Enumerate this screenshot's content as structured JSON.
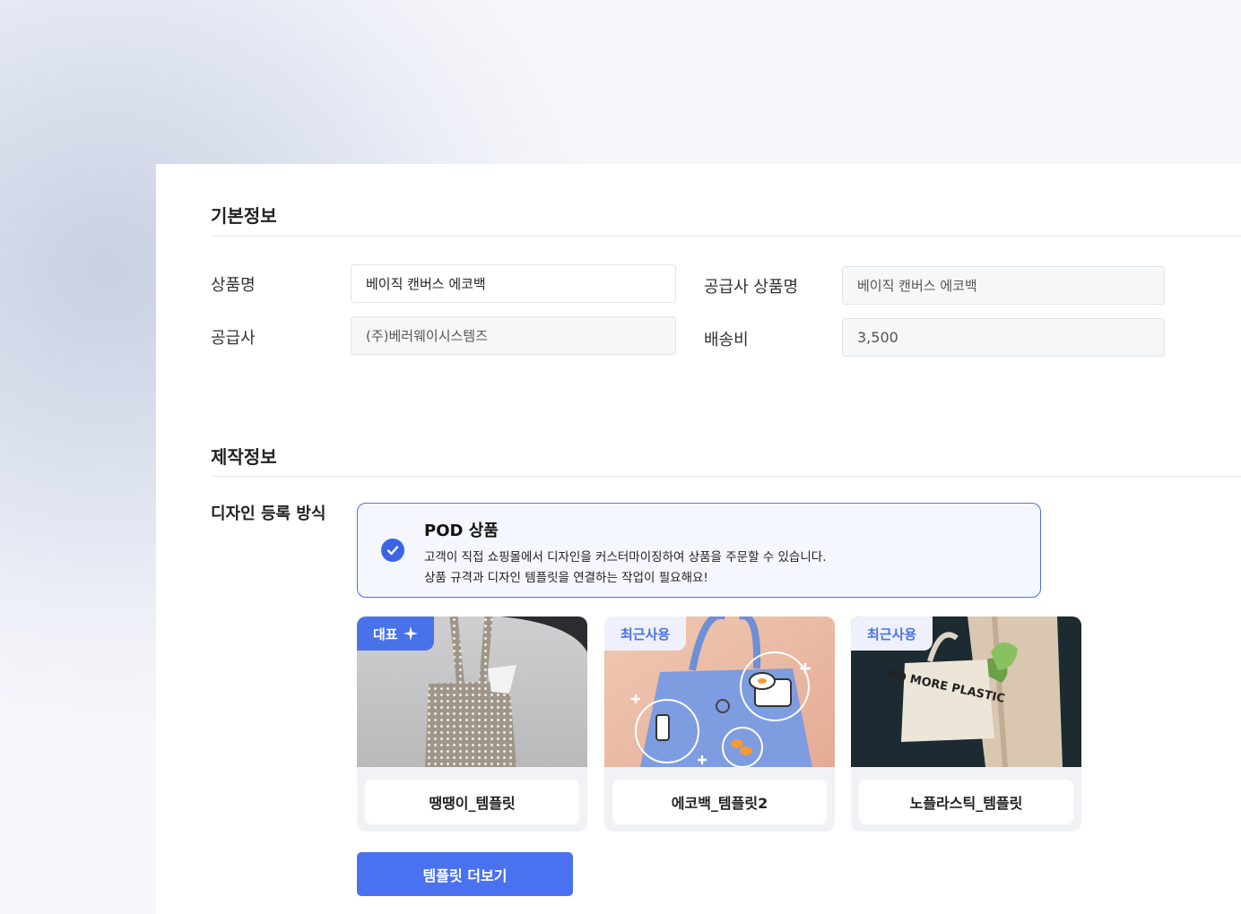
{
  "basic_info": {
    "title": "기본정보",
    "product_name_label": "상품명",
    "product_name_value": "베이직 캔버스 에코백",
    "supplier_product_name_label": "공급사 상품명",
    "supplier_product_name_value": "베이직 캔버스 에코백",
    "supplier_label": "공급사",
    "supplier_value": "(주)베러웨이시스템즈",
    "shipping_label": "배송비",
    "shipping_value": "3,500"
  },
  "production_info": {
    "title": "제작정보",
    "design_method_label": "디자인 등록 방식",
    "pod": {
      "title": "POD 상품",
      "desc1": "고객이 직접 쇼핑몰에서 디자인을 커스터마이징하여 상품을 주문할 수 있습니다.",
      "desc2": "상품 규격과 디자인 템플릿을 연결하는 작업이 필요해요!"
    }
  },
  "templates": [
    {
      "tag": "대표",
      "tag_icon": "sparkle-icon",
      "name": "땡땡이_템플릿"
    },
    {
      "tag": "최근사용",
      "name": "에코백_템플릿2"
    },
    {
      "tag": "최근사용",
      "name": "노플라스틱_템플릿",
      "bag_text": "NO MORE PLASTIC"
    }
  ],
  "more_button": "템플릿 더보기",
  "colors": {
    "accent": "#4a72e8",
    "button": "#4a72f0"
  }
}
